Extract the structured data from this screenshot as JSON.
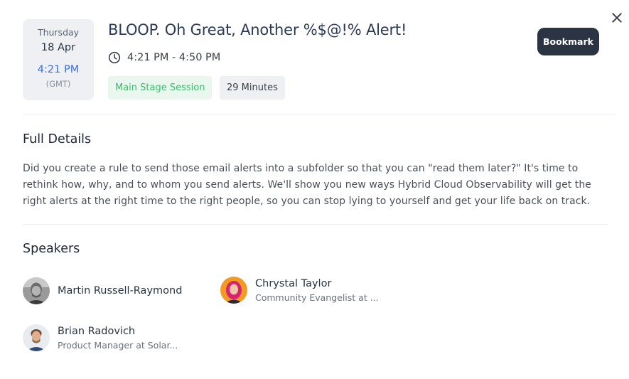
{
  "session": {
    "date_card": {
      "weekday": "Thursday",
      "day_month": "18 Apr",
      "local_time": "4:21 PM",
      "timezone": "(GMT)"
    },
    "title": "BLOOP. Oh Great, Another %$@!% Alert!",
    "time_range": "4:21 PM - 4:50 PM",
    "tags": {
      "stage": "Main Stage Session",
      "duration": "29 Minutes"
    },
    "bookmark_label": "Bookmark"
  },
  "details": {
    "heading": "Full Details",
    "description": "Did you create a rule to send those email alerts into a subfolder so that you can \"read them later?\" It's time to rethink how, why, and to whom you send alerts. We'll show you new ways Hybrid Cloud Observability will get the right alerts at the right time to the right people, so you can stop lying to yourself and get your life back on track."
  },
  "speakers": {
    "heading": "Speakers",
    "items": [
      {
        "name": "Martin Russell-Raymond",
        "role": ""
      },
      {
        "name": "Chrystal Taylor",
        "role": "Community Evangelist at ..."
      },
      {
        "name": "Brian Radovich",
        "role": "Product Manager at Solar..."
      }
    ]
  },
  "icons": {
    "close": "close-icon",
    "clock": "clock-icon"
  },
  "colors": {
    "accent_blue": "#3b6fe0",
    "stage_green": "#3dbb6c",
    "stage_green_bg": "#eaf7ee",
    "bookmark_bg": "#2b3443",
    "card_bg": "#eef0f3"
  }
}
